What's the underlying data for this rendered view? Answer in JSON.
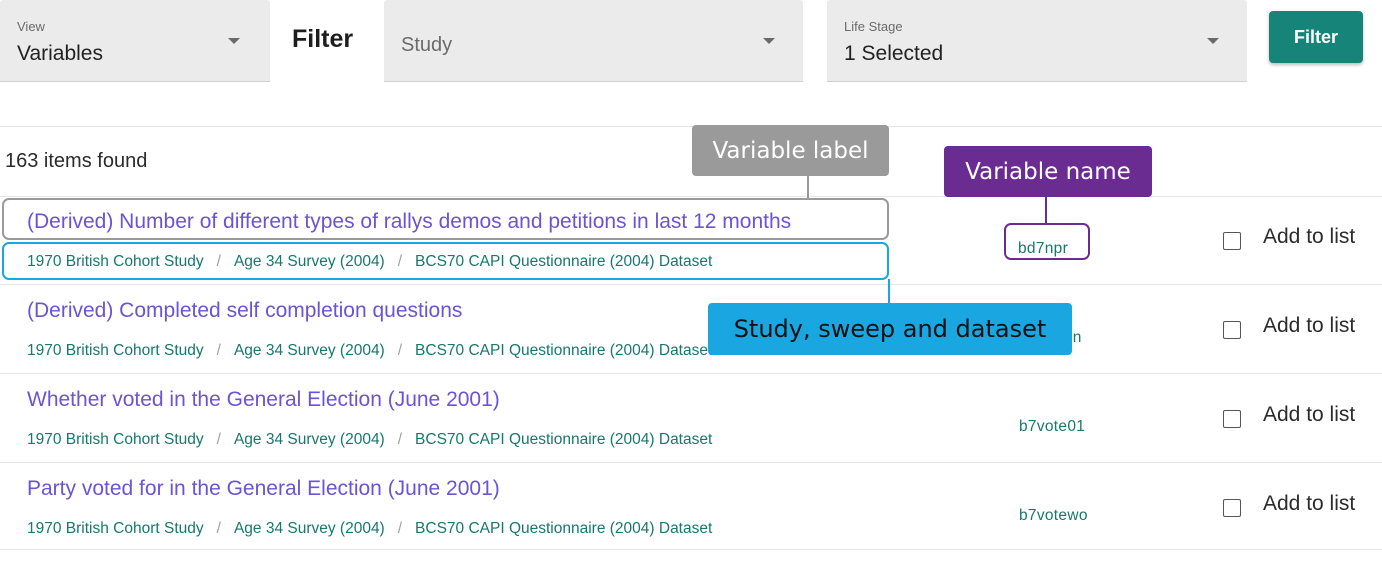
{
  "toolbar": {
    "view": {
      "label": "View",
      "value": "Variables"
    },
    "filter_title": "Filter",
    "study": {
      "placeholder": "Study"
    },
    "life_stage": {
      "label": "Life Stage",
      "value": "1 Selected"
    },
    "filter_button": "Filter"
  },
  "results": {
    "count_text": "163 items found",
    "add_to_list_label": "Add to list",
    "items": [
      {
        "title": "(Derived) Number of different types of rallys demos and petitions in last 12 months",
        "crumbs": [
          "1970 British Cohort Study",
          "Age 34 Survey (2004)",
          "BCS70 CAPI Questionnaire (2004) Dataset"
        ],
        "variable": "bd7npr"
      },
      {
        "title": "(Derived) Completed self completion questions",
        "crumbs": [
          "1970 British Cohort Study",
          "Age 34 Survey (2004)",
          "BCS70 CAPI Questionnaire (2004) Dataset"
        ],
        "variable": "bd7scqdn"
      },
      {
        "title": "Whether voted in the General Election (June 2001)",
        "crumbs": [
          "1970 British Cohort Study",
          "Age 34 Survey (2004)",
          "BCS70 CAPI Questionnaire (2004) Dataset"
        ],
        "variable": "b7vote01"
      },
      {
        "title": "Party voted for in the General Election (June 2001)",
        "crumbs": [
          "1970 British Cohort Study",
          "Age 34 Survey (2004)",
          "BCS70 CAPI Questionnaire (2004) Dataset"
        ],
        "variable": "b7votewo"
      }
    ]
  },
  "annotations": {
    "variable_label": "Variable label",
    "variable_name": "Variable name",
    "study_sweep_dataset": "Study, sweep and dataset"
  },
  "colors": {
    "accent": "#17847a",
    "link": "#6a54d6",
    "annotation_gray": "#9a9a9a",
    "annotation_purple": "#6a2c91",
    "annotation_blue": "#1aa6e0"
  }
}
